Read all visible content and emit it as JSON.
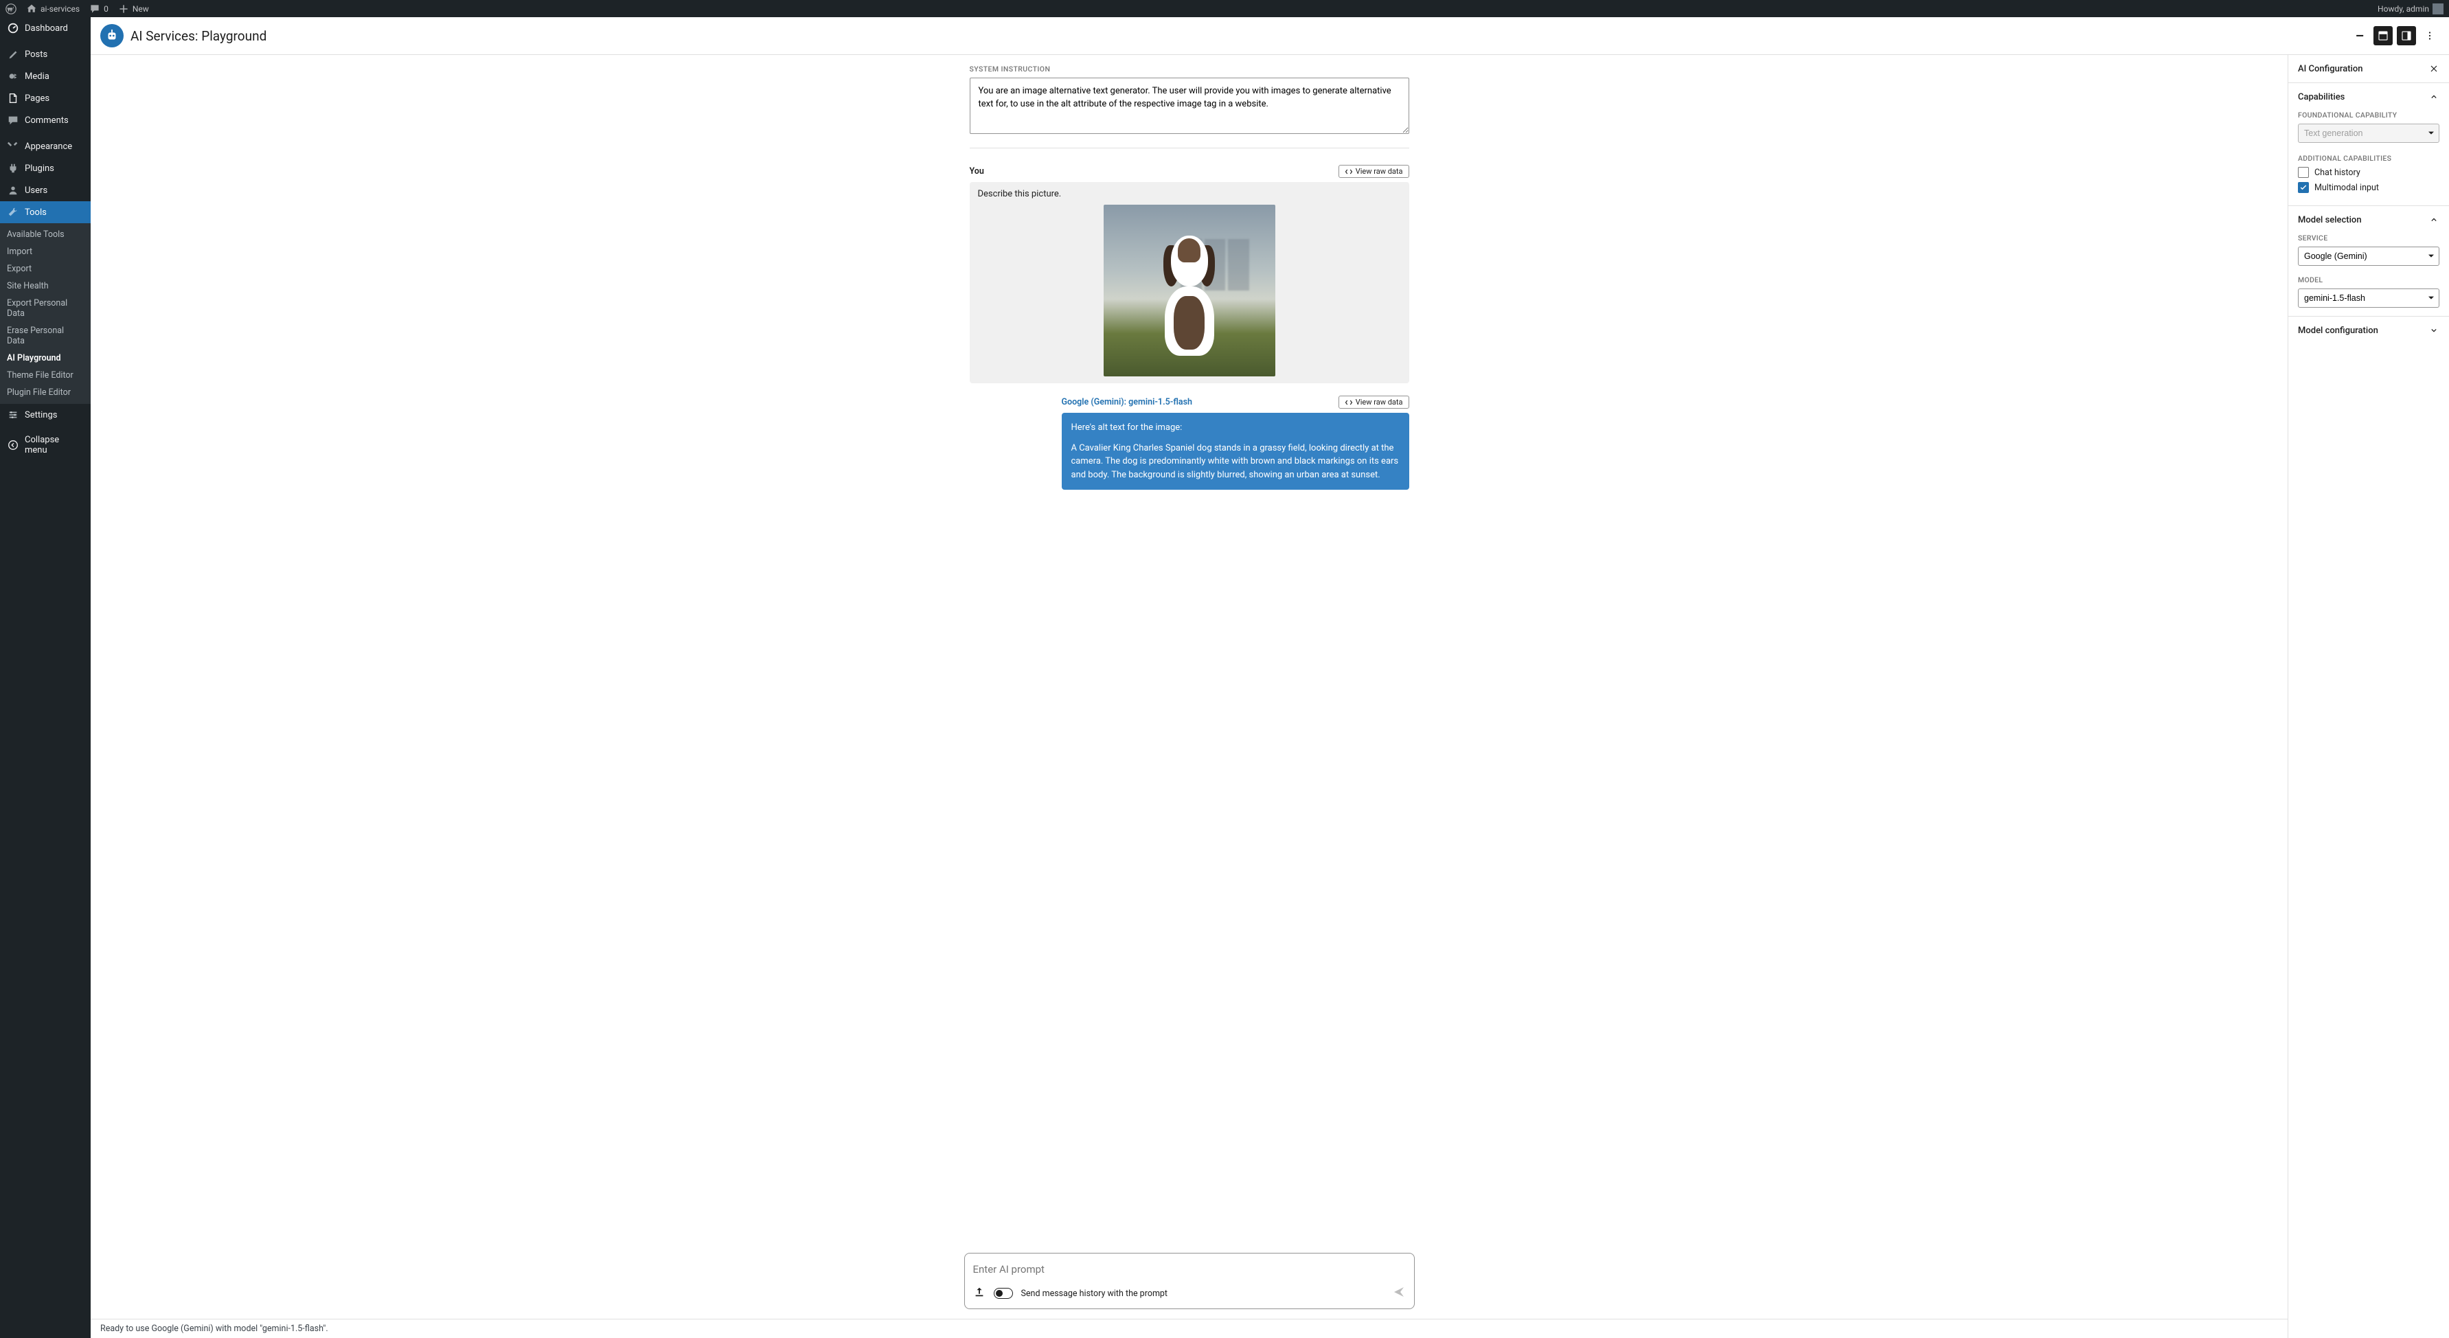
{
  "adminbar": {
    "site_name": "ai-services",
    "comments_count": "0",
    "new_label": "New",
    "greeting": "Howdy, admin"
  },
  "sidebar": {
    "items": [
      {
        "label": "Dashboard"
      },
      {
        "label": "Posts"
      },
      {
        "label": "Media"
      },
      {
        "label": "Pages"
      },
      {
        "label": "Comments"
      },
      {
        "label": "Appearance"
      },
      {
        "label": "Plugins"
      },
      {
        "label": "Users"
      },
      {
        "label": "Tools"
      },
      {
        "label": "Settings"
      }
    ],
    "tools_submenu": [
      {
        "label": "Available Tools"
      },
      {
        "label": "Import"
      },
      {
        "label": "Export"
      },
      {
        "label": "Site Health"
      },
      {
        "label": "Export Personal Data"
      },
      {
        "label": "Erase Personal Data"
      },
      {
        "label": "AI Playground"
      },
      {
        "label": "Theme File Editor"
      },
      {
        "label": "Plugin File Editor"
      }
    ],
    "collapse_label": "Collapse menu"
  },
  "page": {
    "title": "AI Services: Playground",
    "system_instruction_label": "SYSTEM INSTRUCTION",
    "system_instruction": "You are an image alternative text generator. The user will provide you with images to generate alternative text for, to use in the alt attribute of the respective image tag in a website.",
    "view_raw_label": "View raw data"
  },
  "conversation": {
    "user_label": "You",
    "user_text": "Describe this picture.",
    "model_label": "Google (Gemini): gemini-1.5-flash",
    "model_text_1": "Here's alt text for the image:",
    "model_text_2": "A Cavalier King Charles Spaniel dog stands in a grassy field, looking directly at the camera. The dog is predominantly white with brown and black markings on its ears and body. The background is slightly blurred, showing an urban area at sunset."
  },
  "input": {
    "placeholder": "Enter AI prompt",
    "toggle_label": "Send message history with the prompt"
  },
  "status_bar": "Ready to use Google (Gemini) with model \"gemini-1.5-flash\".",
  "right_panel": {
    "title": "AI Configuration",
    "capabilities_title": "Capabilities",
    "foundational_label": "FOUNDATIONAL CAPABILITY",
    "foundational_value": "Text generation",
    "additional_label": "ADDITIONAL CAPABILITIES",
    "cap_chat": "Chat history",
    "cap_multimodal": "Multimodal input",
    "model_selection_title": "Model selection",
    "service_label": "SERVICE",
    "service_value": "Google (Gemini)",
    "model_label": "MODEL",
    "model_value": "gemini-1.5-flash",
    "model_config_title": "Model configuration"
  }
}
